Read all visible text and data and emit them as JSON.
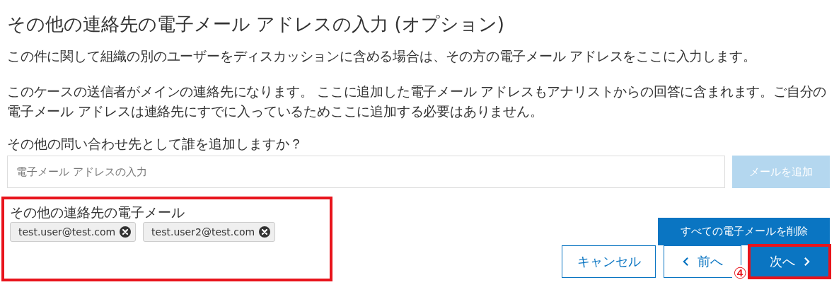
{
  "title": "その他の連絡先の電子メール アドレスの入力 (オプション)",
  "paragraphs": [
    "この件に関して組織の別のユーザーをディスカッションに含める場合は、その方の電子メール アドレスをここに入力します。",
    "このケースの送信者がメインの連絡先になります。 ここに追加した電子メール アドレスもアナリストからの回答に含まれます。ご自分の電子メール アドレスは連絡先にすでに入っているためここに追加する必要はありません。"
  ],
  "question": "その他の問い合わせ先として誰を追加しますか？",
  "email_field": {
    "placeholder": "電子メール アドレスの入力"
  },
  "add_button": {
    "label": "メールを追加",
    "disabled": true
  },
  "contacts": {
    "label": "その他の連絡先の電子メール",
    "highlighted": true,
    "emails": [
      "test.user@test.com",
      "test.user2@test.com"
    ]
  },
  "remove_all_button": {
    "label": "すべての電子メールを削除"
  },
  "nav_buttons": [
    {
      "kind": "cancel",
      "label": "キャンセル",
      "highlighted": false
    },
    {
      "kind": "prev",
      "label": "前へ",
      "highlighted": false
    },
    {
      "kind": "next",
      "label": "次へ",
      "highlighted": true
    }
  ],
  "step_marker": "④"
}
